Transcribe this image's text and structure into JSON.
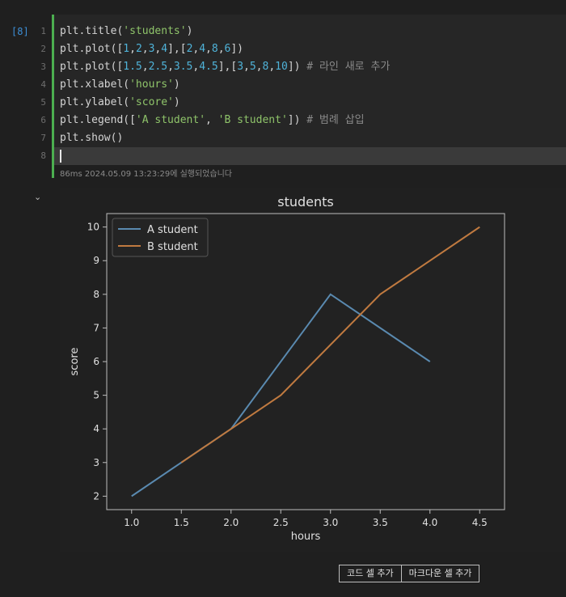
{
  "cell": {
    "execution_count": "[8]",
    "lines": [
      {
        "num": "1",
        "tokens": [
          [
            "fn",
            "plt.title("
          ],
          [
            "str",
            "'students'"
          ],
          [
            "fn",
            ")"
          ]
        ]
      },
      {
        "num": "2",
        "tokens": [
          [
            "fn",
            "plt.plot(["
          ],
          [
            "num",
            "1"
          ],
          [
            "fn",
            ","
          ],
          [
            "num",
            "2"
          ],
          [
            "fn",
            ","
          ],
          [
            "num",
            "3"
          ],
          [
            "fn",
            ","
          ],
          [
            "num",
            "4"
          ],
          [
            "fn",
            "],["
          ],
          [
            "num",
            "2"
          ],
          [
            "fn",
            ","
          ],
          [
            "num",
            "4"
          ],
          [
            "fn",
            ","
          ],
          [
            "num",
            "8"
          ],
          [
            "fn",
            ","
          ],
          [
            "num",
            "6"
          ],
          [
            "fn",
            "])"
          ]
        ]
      },
      {
        "num": "3",
        "tokens": [
          [
            "fn",
            "plt.plot(["
          ],
          [
            "num",
            "1.5"
          ],
          [
            "fn",
            ","
          ],
          [
            "num",
            "2.5"
          ],
          [
            "fn",
            ","
          ],
          [
            "num",
            "3.5"
          ],
          [
            "fn",
            ","
          ],
          [
            "num",
            "4.5"
          ],
          [
            "fn",
            "],["
          ],
          [
            "num",
            "3"
          ],
          [
            "fn",
            ","
          ],
          [
            "num",
            "5"
          ],
          [
            "fn",
            ","
          ],
          [
            "num",
            "8"
          ],
          [
            "fn",
            ","
          ],
          [
            "num",
            "10"
          ],
          [
            "fn",
            "]) "
          ],
          [
            "cm",
            "# 라인 새로 추가"
          ]
        ]
      },
      {
        "num": "4",
        "tokens": [
          [
            "fn",
            "plt.xlabel("
          ],
          [
            "str",
            "'hours'"
          ],
          [
            "fn",
            ")"
          ]
        ]
      },
      {
        "num": "5",
        "tokens": [
          [
            "fn",
            "plt.ylabel("
          ],
          [
            "str",
            "'score'"
          ],
          [
            "fn",
            ")"
          ]
        ]
      },
      {
        "num": "6",
        "tokens": [
          [
            "fn",
            "plt.legend(["
          ],
          [
            "str",
            "'A student'"
          ],
          [
            "fn",
            ", "
          ],
          [
            "str",
            "'B student'"
          ],
          [
            "fn",
            "]) "
          ],
          [
            "cm",
            "# 범례 삽입"
          ]
        ]
      },
      {
        "num": "7",
        "tokens": [
          [
            "fn",
            "plt.show()"
          ]
        ]
      },
      {
        "num": "8",
        "tokens": []
      }
    ],
    "status": "86ms 2024.05.09 13:23:29에 실행되었습니다"
  },
  "colors": {
    "series_a": "#5a8ab0",
    "series_b": "#c07a40",
    "cell_bar": "#4caf50"
  },
  "icons": {
    "collapse": "chevron-down-icon"
  },
  "collapse_glyph": "⌄",
  "chart_data": {
    "type": "line",
    "title": "students",
    "xlabel": "hours",
    "ylabel": "score",
    "xlim": [
      0.75,
      4.75
    ],
    "ylim": [
      1.6,
      10.4
    ],
    "xticks": [
      "1.0",
      "1.5",
      "2.0",
      "2.5",
      "3.0",
      "3.5",
      "4.0",
      "4.5"
    ],
    "xtick_values": [
      1.0,
      1.5,
      2.0,
      2.5,
      3.0,
      3.5,
      4.0,
      4.5
    ],
    "yticks": [
      "2",
      "3",
      "4",
      "5",
      "6",
      "7",
      "8",
      "9",
      "10"
    ],
    "ytick_values": [
      2,
      3,
      4,
      5,
      6,
      7,
      8,
      9,
      10
    ],
    "legend_position": "upper-left",
    "series": [
      {
        "name": "A student",
        "x": [
          1,
          2,
          3,
          4
        ],
        "y": [
          2,
          4,
          8,
          6
        ],
        "color": "#5a8ab0"
      },
      {
        "name": "B student",
        "x": [
          1.5,
          2.5,
          3.5,
          4.5
        ],
        "y": [
          3,
          5,
          8,
          10
        ],
        "color": "#c07a40"
      }
    ]
  },
  "footer": {
    "add_code": "코드 셀 추가",
    "add_markdown": "마크다운 셀 추가"
  }
}
